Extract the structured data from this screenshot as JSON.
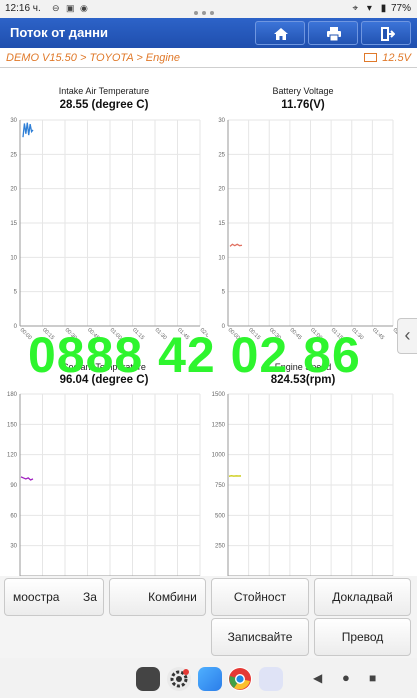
{
  "status": {
    "time": "12:16 ч.",
    "battery": "77%"
  },
  "header": {
    "title": "Поток от данни"
  },
  "breadcrumb": {
    "path": "DEMO V15.50 > TOYOTA > Engine",
    "voltage": "12.5V"
  },
  "watermark": "0888 42 02 86",
  "charts": [
    {
      "title": "Intake Air Temperature",
      "value": "28.55 (degree C)",
      "ylim": [
        0,
        30
      ],
      "yticks": [
        "30",
        "25",
        "20",
        "15",
        "10",
        "5",
        "0"
      ],
      "xticks": [
        "00:00",
        "00:15",
        "00:30",
        "00:45",
        "01:00",
        "01:15",
        "01:30",
        "01:45",
        "02:00"
      ],
      "series_color": "#2f7fd6"
    },
    {
      "title": "Battery Voltage",
      "value": "11.76(V)",
      "ylim": [
        0,
        30
      ],
      "yticks": [
        "30",
        "25",
        "20",
        "15",
        "10",
        "5",
        "0"
      ],
      "xticks": [
        "00:00",
        "00:15",
        "00:30",
        "00:45",
        "01:00",
        "01:15",
        "01:30",
        "01:45",
        "02:00"
      ],
      "series_color": "#e07060"
    },
    {
      "title": "Coolant Temperature",
      "value": "96.04 (degree C)",
      "ylim": [
        0,
        180
      ],
      "yticks": [
        "180",
        "150",
        "120",
        "90",
        "60",
        "30"
      ],
      "series_color": "#a020c0"
    },
    {
      "title": "Engine Speed",
      "value": "824.53(rpm)",
      "ylim": [
        0,
        1500
      ],
      "yticks": [
        "1500",
        "1250",
        "1000",
        "750",
        "500",
        "250"
      ],
      "series_color": "#c8c800"
    }
  ],
  "chart_data": [
    {
      "type": "line",
      "title": "Intake Air Temperature",
      "ylabel": "",
      "ylim": [
        0,
        30
      ],
      "x": [
        0,
        1,
        2,
        3,
        4,
        5,
        6,
        7
      ],
      "series": [
        {
          "values": [
            27.5,
            29.5,
            28.0,
            29.6,
            27.8,
            29.4,
            28.3,
            28.55
          ]
        }
      ]
    },
    {
      "type": "line",
      "title": "Battery Voltage",
      "ylim": [
        0,
        30
      ],
      "x": [
        0,
        1,
        2,
        3,
        4,
        5
      ],
      "series": [
        {
          "values": [
            11.6,
            11.9,
            11.7,
            11.9,
            11.7,
            11.76
          ]
        }
      ]
    },
    {
      "type": "line",
      "title": "Coolant Temperature",
      "ylim": [
        0,
        180
      ],
      "x": [
        0,
        1,
        2,
        3,
        4,
        5
      ],
      "series": [
        {
          "values": [
            98,
            97,
            96,
            97,
            95,
            96.04
          ]
        }
      ]
    },
    {
      "type": "line",
      "title": "Engine Speed",
      "ylim": [
        0,
        1500
      ],
      "x": [
        0,
        1,
        2,
        3,
        4,
        5
      ],
      "series": [
        {
          "values": [
            822,
            826,
            823,
            825,
            824,
            824.53
          ]
        }
      ]
    }
  ],
  "buttons": {
    "b1": "моостра",
    "b1b": "За",
    "b2": "Комбини",
    "b3": "Стойност",
    "b4": "Докладвай",
    "b5": "Записвайте",
    "b6": "Превод"
  }
}
